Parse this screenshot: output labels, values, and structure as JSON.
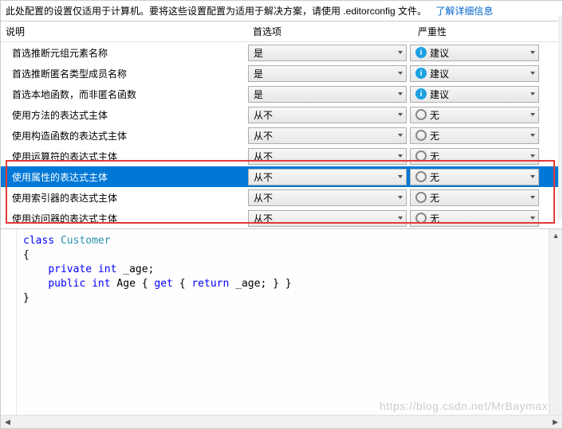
{
  "banner": {
    "text_part1": "此处配置的设置仅适用于计算机。要将这些设置配置为适用于解决方案，请使用 .editorconfig 文件。",
    "link": "了解详细信息"
  },
  "headers": {
    "desc": "说明",
    "pref": "首选项",
    "sev": "严重性"
  },
  "sev_labels": {
    "suggest": "建议",
    "none": "无"
  },
  "rows": [
    {
      "desc": "首选推断元组元素名称",
      "pref": "是",
      "sev": "建议",
      "sev_kind": "info",
      "selected": false
    },
    {
      "desc": "首选推断匿名类型成员名称",
      "pref": "是",
      "sev": "建议",
      "sev_kind": "info",
      "selected": false
    },
    {
      "desc": "首选本地函数，而非匿名函数",
      "pref": "是",
      "sev": "建议",
      "sev_kind": "info",
      "selected": false
    },
    {
      "desc": "使用方法的表达式主体",
      "pref": "从不",
      "sev": "无",
      "sev_kind": "none",
      "selected": false
    },
    {
      "desc": "使用构造函数的表达式主体",
      "pref": "从不",
      "sev": "无",
      "sev_kind": "none",
      "selected": false
    },
    {
      "desc": "使用运算符的表达式主体",
      "pref": "从不",
      "sev": "无",
      "sev_kind": "none",
      "selected": false
    },
    {
      "desc": "使用属性的表达式主体",
      "pref": "从不",
      "sev": "无",
      "sev_kind": "none",
      "selected": true
    },
    {
      "desc": "使用索引器的表达式主体",
      "pref": "从不",
      "sev": "无",
      "sev_kind": "none",
      "selected": false
    },
    {
      "desc": "使用访问器的表达式主体",
      "pref": "从不",
      "sev": "无",
      "sev_kind": "none",
      "selected": false
    }
  ],
  "code": {
    "line1_kw": "class",
    "line1_type": " Customer",
    "line2": "{",
    "line3_pre": "    ",
    "line3_kw1": "private",
    "line3_kw2": " int",
    "line3_rest": " _age;",
    "line4_pre": "    ",
    "line4_kw1": "public",
    "line4_kw2": " int",
    "line4_rest1": " Age { ",
    "line4_kw3": "get",
    "line4_rest2": " { ",
    "line4_kw4": "return",
    "line4_rest3": " _age; } }",
    "line5": "}"
  },
  "watermark": "https://blog.csdn.net/MrBaymax"
}
